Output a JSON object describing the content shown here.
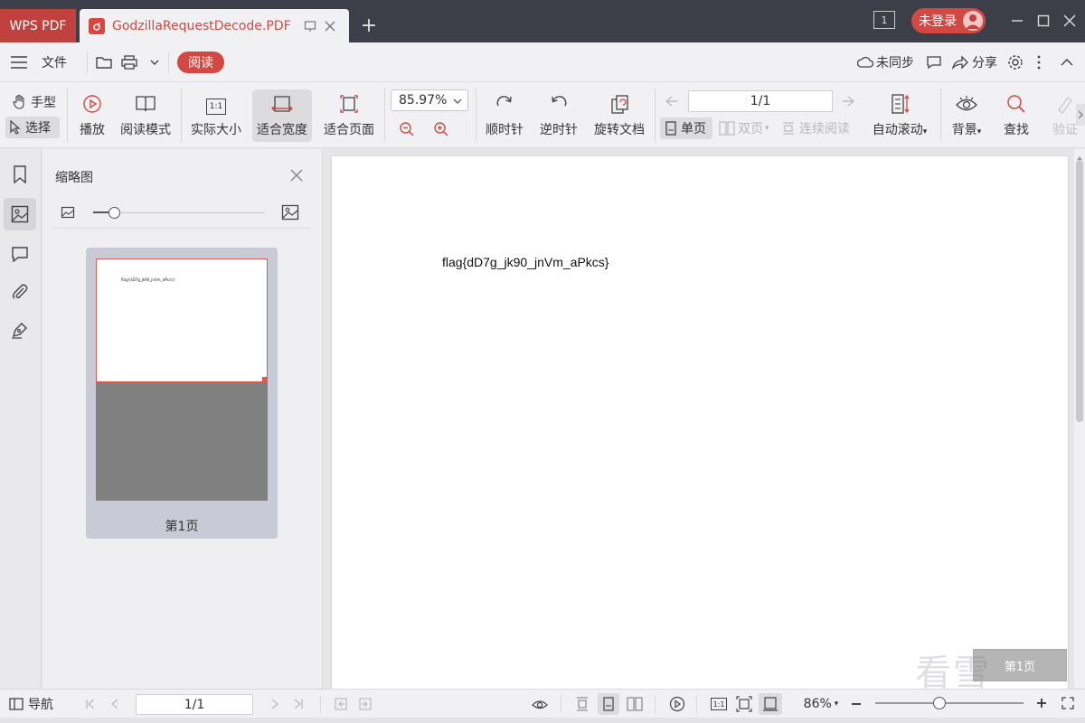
{
  "app": {
    "name": "WPS PDF",
    "doc_tab_title": "GodzillaRequestDecode.PDF",
    "new_tab_symbol": "+",
    "window_count": "1",
    "login_label": "未登录"
  },
  "menubar": {
    "file_label": "文件",
    "read_label": "阅读",
    "sync_label": "未同步",
    "share_label": "分享"
  },
  "toolbar": {
    "hand_label": "手型",
    "select_label": "选择",
    "play_label": "播放",
    "read_mode_label": "阅读模式",
    "actual_size_label": "实际大小",
    "actual_size_icon_text": "1:1",
    "fit_width_label": "适合宽度",
    "fit_page_label": "适合页面",
    "zoom_value": "85.97%",
    "clockwise_label": "顺时针",
    "counter_clockwise_label": "逆时针",
    "rotate_doc_label": "旋转文档",
    "page_value": "1/1",
    "single_page_label": "单页",
    "double_page_label": "双页",
    "continuous_label": "连续阅读",
    "auto_scroll_label": "自动滚动",
    "background_label": "背景",
    "find_label": "查找",
    "verify_label": "验证"
  },
  "thumbnail_panel": {
    "title": "缩略图",
    "slider_value": 0.12,
    "page_label": "第1页",
    "mini_text": "flag{dD7g_jk90_jnVm_aPkcs}"
  },
  "document": {
    "content_text": "flag{dD7g_jk90_jnVm_aPkcs}",
    "page_indicator": "第1页",
    "watermark": "看雪"
  },
  "statusbar": {
    "nav_label": "导航",
    "page_value": "1/1",
    "fit_icon_text": "1:1",
    "zoom_label": "86%",
    "zoom_fraction": 0.43
  },
  "colors": {
    "accent": "#d24944",
    "titlebar": "#3c3f48",
    "toolbar_bg": "#f1f1f3"
  }
}
